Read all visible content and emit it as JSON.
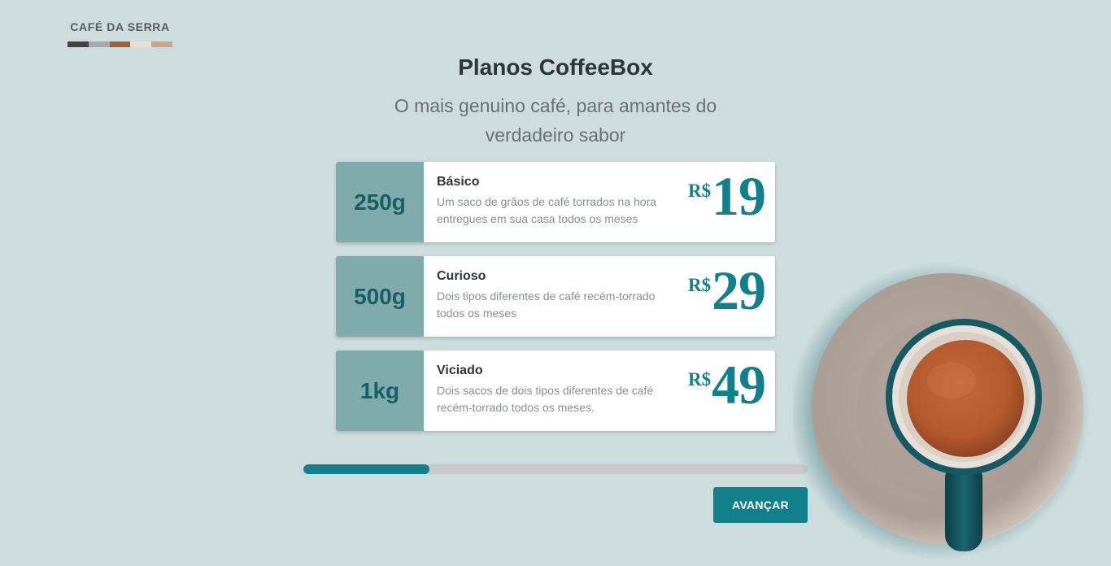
{
  "brand": {
    "name": "CAFÉ DA SERRA",
    "palette": [
      "#4a403d",
      "#a7a7a7",
      "#a7603f",
      "#e9ddd2",
      "#d3a088"
    ]
  },
  "header": {
    "title": "Planos CoffeeBox",
    "subtitle": "O mais genuino café, para amantes do verdadeiro sabor"
  },
  "plans": [
    {
      "weight": "250g",
      "name": "Básico",
      "description": "Um saco de grãos de café torrados na hora entregues em sua casa todos os meses",
      "currency": "R$",
      "price": "19"
    },
    {
      "weight": "500g",
      "name": "Curioso",
      "description": "Dois tipos diferentes de café recém-torrado todos os meses",
      "currency": "R$",
      "price": "29"
    },
    {
      "weight": "1kg",
      "name": "Viciado",
      "description": "Dois sacos de dois tipos diferentes de café recém-torrado todos os meses.",
      "currency": "R$",
      "price": "49"
    }
  ],
  "progress": {
    "percent": 25
  },
  "actions": {
    "next_label": "AVANÇAR"
  },
  "colors": {
    "background": "#cddcdd",
    "accent": "#11808a",
    "weight_panel": "#7fabad"
  }
}
